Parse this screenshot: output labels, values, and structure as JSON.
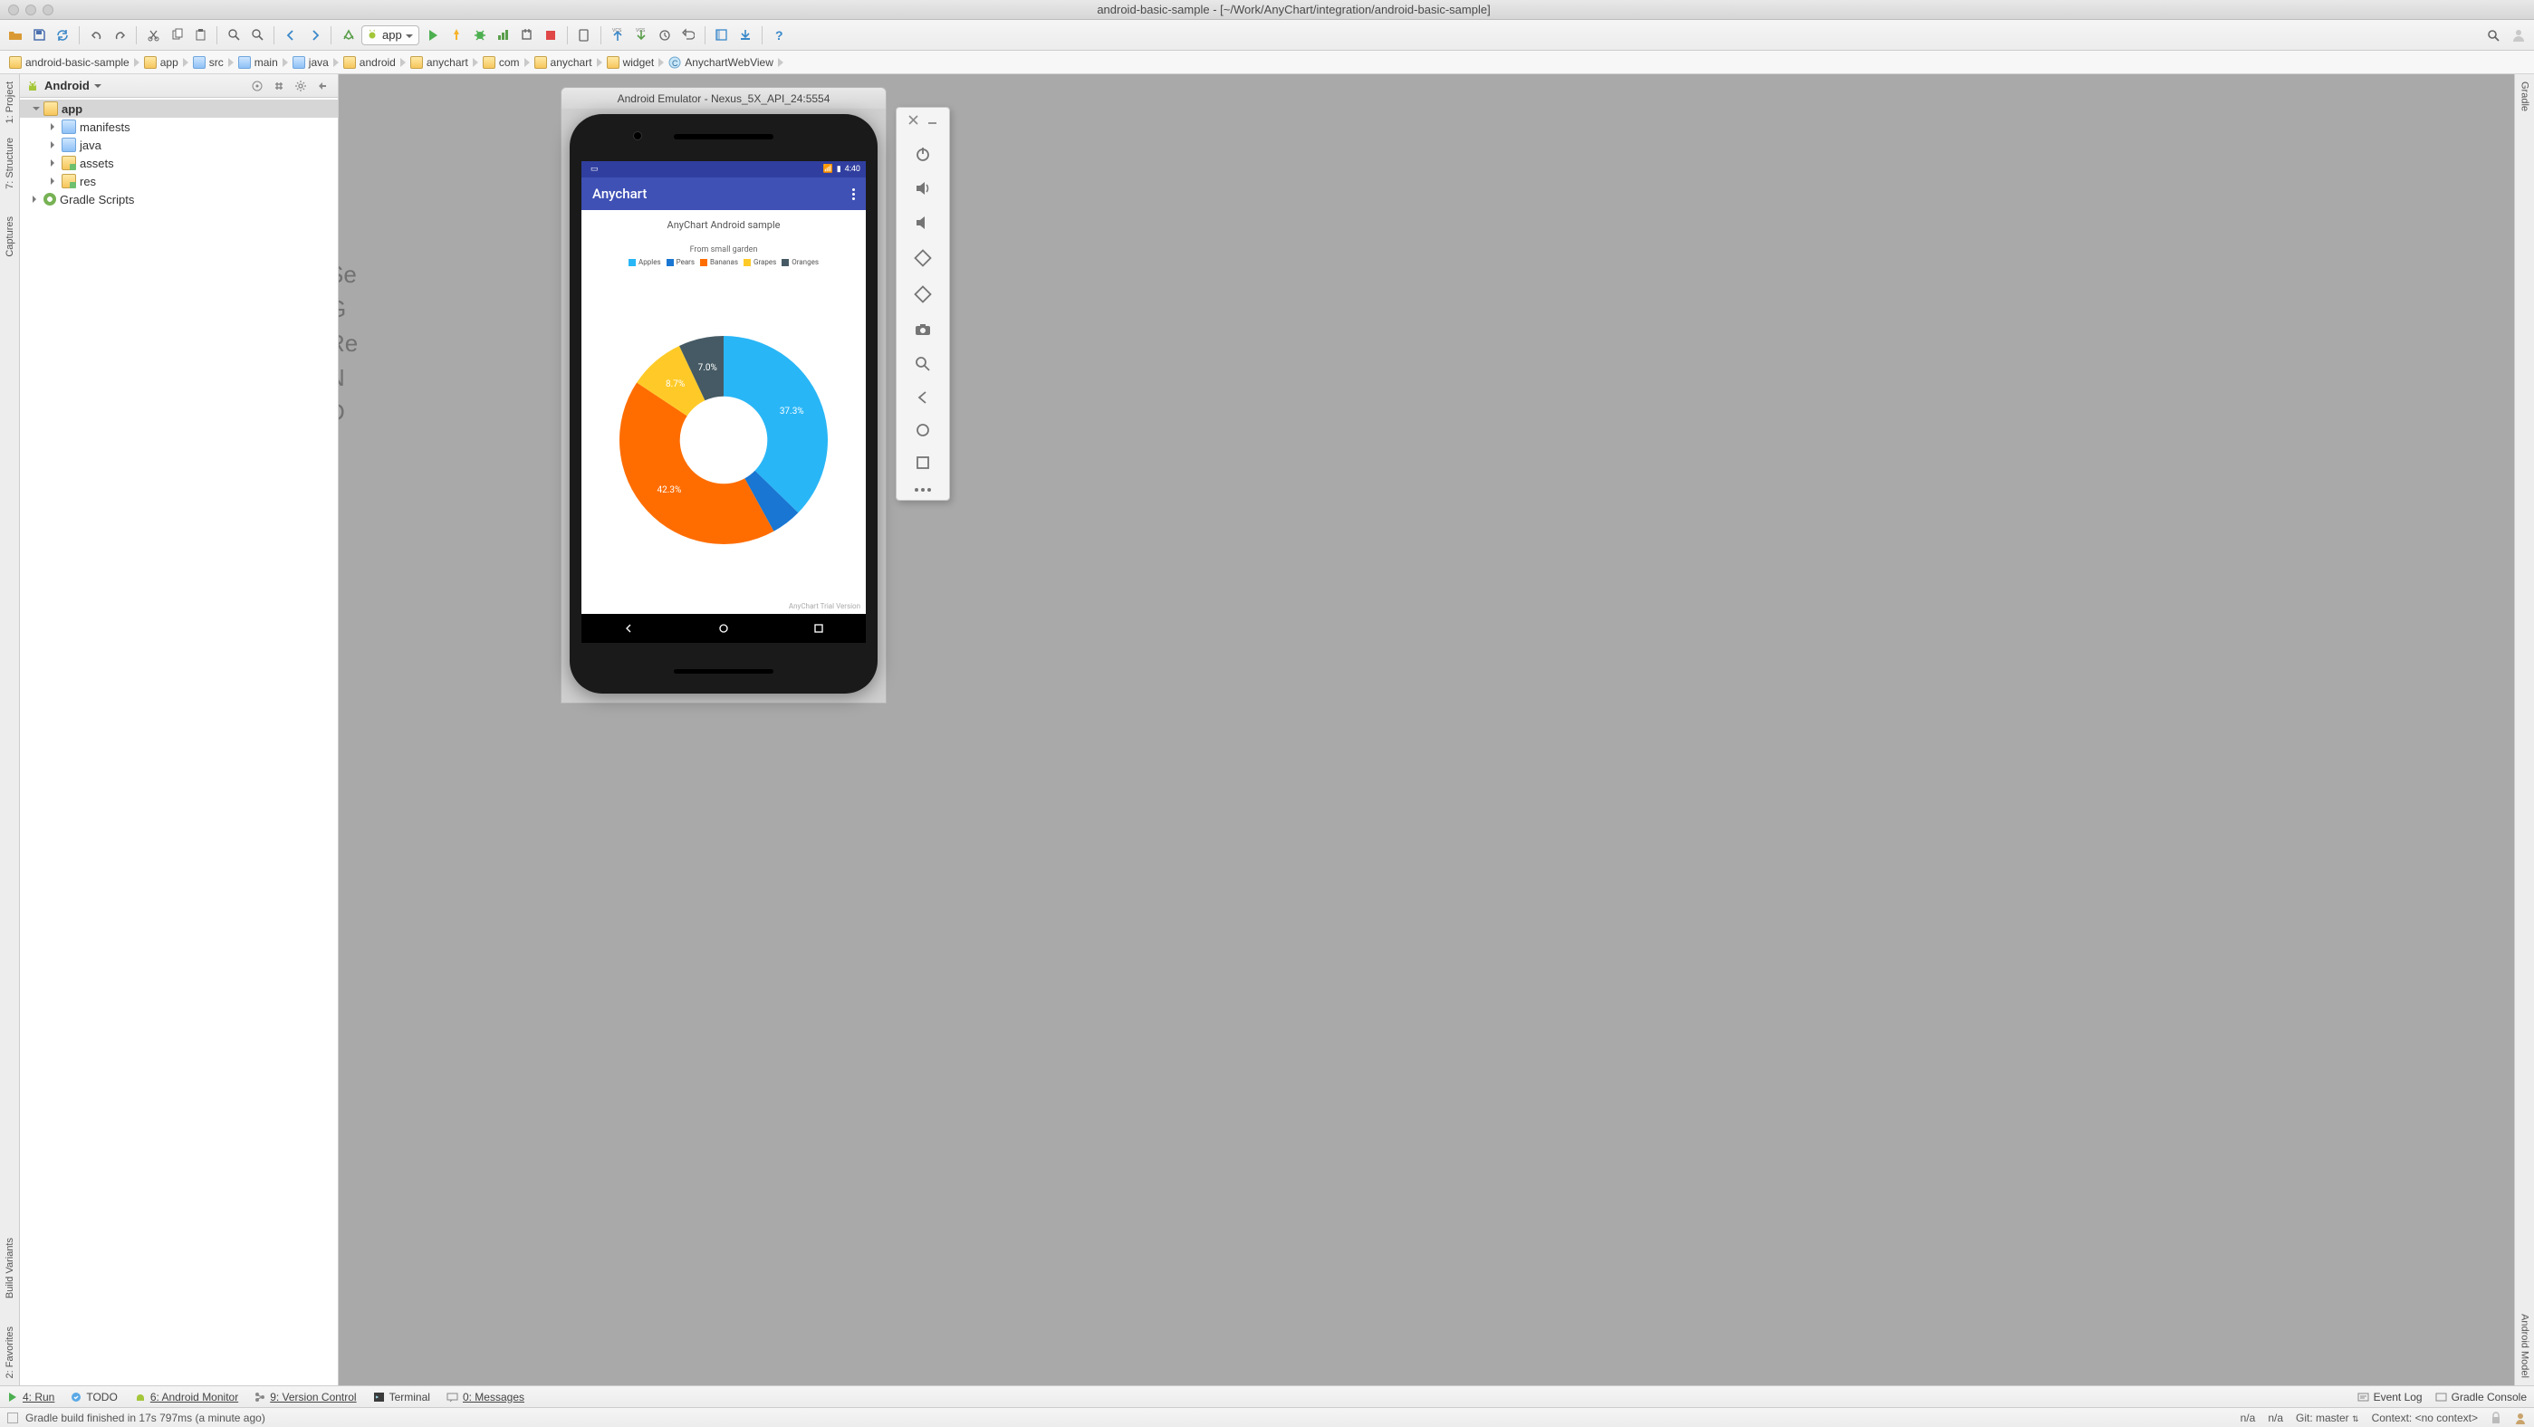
{
  "window": {
    "title": "android-basic-sample - [~/Work/AnyChart/integration/android-basic-sample]"
  },
  "run_config": {
    "label": "app"
  },
  "breadcrumbs": [
    "android-basic-sample",
    "app",
    "src",
    "main",
    "java",
    "android",
    "anychart",
    "com",
    "anychart",
    "widget",
    "AnychartWebView"
  ],
  "projectPane": {
    "view": "Android",
    "tree": {
      "app": "app",
      "manifests": "manifests",
      "java": "java",
      "assets": "assets",
      "res": "res",
      "gradle": "Gradle Scripts"
    }
  },
  "leftRail": {
    "project": "1: Project",
    "structure": "7: Structure",
    "captures": "Captures",
    "buildVariants": "Build Variants",
    "favorites": "2: Favorites"
  },
  "rightRail": {
    "gradle": "Gradle",
    "androidModel": "Android Model"
  },
  "bgLabels": [
    "Se",
    "G",
    "Re",
    "N",
    "D"
  ],
  "emulator": {
    "title": "Android Emulator - Nexus_5X_API_24:5554",
    "status_time": "4:40",
    "app_title": "Anychart",
    "chart_title": "AnyChart Android sample",
    "chart_sub": "From small garden",
    "trial": "AnyChart Trial Version"
  },
  "chart_data": {
    "type": "pie",
    "title": "AnyChart Android sample",
    "subtitle": "From small garden",
    "inner_radius_pct": 42,
    "series": [
      {
        "name": "Apples",
        "value": 37.3,
        "color": "#29b6f6"
      },
      {
        "name": "Pears",
        "value": 4.7,
        "color": "#1976d2"
      },
      {
        "name": "Bananas",
        "value": 42.3,
        "color": "#ff6d00"
      },
      {
        "name": "Grapes",
        "value": 8.7,
        "color": "#ffca28"
      },
      {
        "name": "Oranges",
        "value": 7.0,
        "color": "#455a64"
      }
    ],
    "visible_labels": [
      "37.3%",
      "42.3%",
      "8.7%",
      "7.0%"
    ]
  },
  "bottomBar": {
    "run": "4: Run",
    "todo": "TODO",
    "monitor": "6: Android Monitor",
    "vcs": "9: Version Control",
    "terminal": "Terminal",
    "messages": "0: Messages",
    "eventlog": "Event Log",
    "gradleConsole": "Gradle Console"
  },
  "statusBar": {
    "msg": "Gradle build finished in 17s 797ms (a minute ago)",
    "na1": "n/a",
    "na2": "n/a",
    "git": "Git: master",
    "context": "Context: <no context>"
  }
}
